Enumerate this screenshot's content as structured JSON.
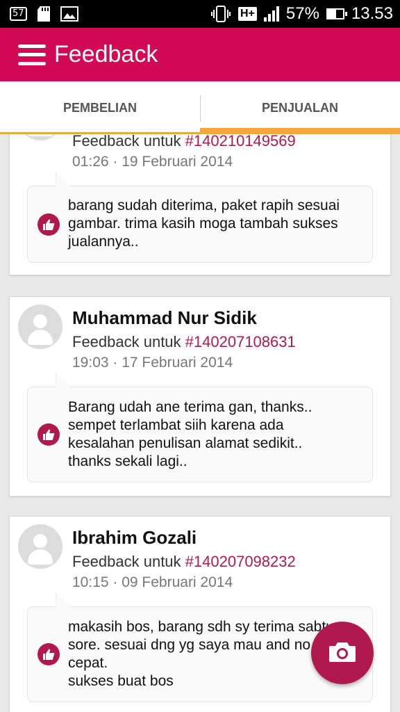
{
  "status_bar": {
    "notification_count": "57",
    "network": "H+",
    "battery_percent": "57%",
    "battery_level": 0.57,
    "time": "13.53",
    "icons": [
      "notification-icon",
      "sdcard-icon",
      "image-icon",
      "vibrate-icon",
      "hplus-icon",
      "signal-icon",
      "battery-icon"
    ]
  },
  "app_bar": {
    "title": "Feedback",
    "menu_icon": "hamburger-icon",
    "color": "#d10a53"
  },
  "tabs": [
    {
      "label": "PEMBELIAN",
      "selected": false
    },
    {
      "label": "PENJUALAN",
      "selected": true
    }
  ],
  "accent_color": "#f4a63a",
  "invoice_color": "#b0194e",
  "feedbacks": [
    {
      "name": "",
      "feedback_prefix": "Feedback untuk ",
      "invoice": "#140210149569",
      "date": "01:26 · 19 Februari 2014",
      "review": "barang sudah diterima, paket rapih sesuai\ngambar. trima kasih moga tambah sukses\njualannya.."
    },
    {
      "name": "Muhammad Nur Sidik",
      "feedback_prefix": "Feedback untuk ",
      "invoice": "#140207108631",
      "date": "19:03 · 17 Februari 2014",
      "review": "Barang udah ane terima gan, thanks..\nsempet terlambat siih karena ada\nkesalahan penulisan alamat sedikit..\nthanks sekali lagi.."
    },
    {
      "name": "Ibrahim Gozali",
      "feedback_prefix": "Feedback untuk ",
      "invoice": "#140207098232",
      "date": "10:15 · 09 Februari 2014",
      "review": "makasih bos, barang sdh sy terima sabtu\nsore. sesuai dng yg saya mau and no\ncepat.\nsukses buat bos"
    }
  ],
  "fab": {
    "icon": "camera-icon"
  }
}
